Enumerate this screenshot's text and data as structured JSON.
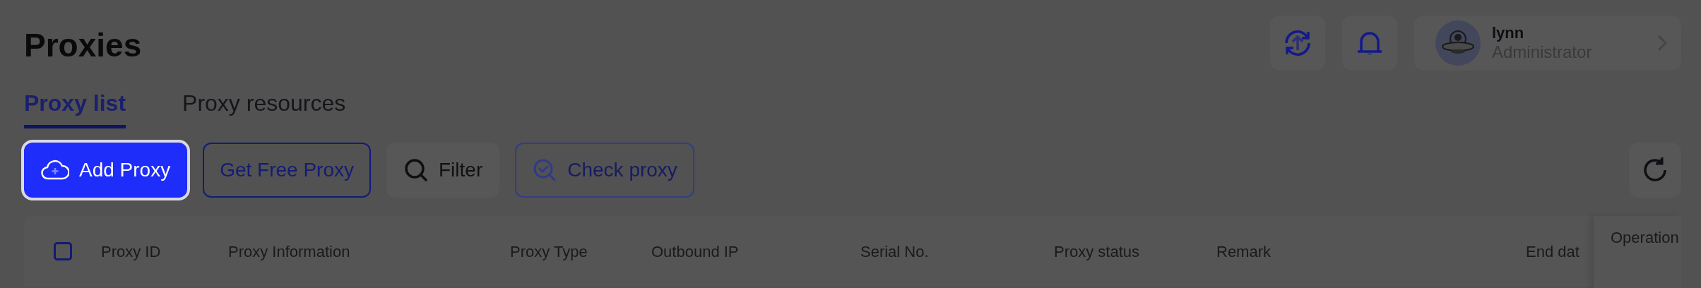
{
  "header": {
    "title": "Proxies",
    "user": {
      "name": "lynn",
      "role": "Administrator"
    }
  },
  "tabs": [
    {
      "label": "Proxy list",
      "selected": true
    },
    {
      "label": "Proxy resources",
      "selected": false
    }
  ],
  "toolbar": [
    {
      "label": "Add Proxy",
      "kind": "primary",
      "disabled": false
    },
    {
      "label": "Get Free Proxy",
      "kind": "outline",
      "disabled": false
    },
    {
      "label": "Filter",
      "kind": "filter",
      "disabled": false
    },
    {
      "label": "Check proxy",
      "kind": "check",
      "disabled": true
    }
  ],
  "table": {
    "select_all": {
      "checked": false
    },
    "columns": [
      "Proxy ID",
      "Proxy Information",
      "Proxy Type",
      "Outbound IP",
      "Serial No.",
      "Proxy status",
      "Remark",
      "End dat"
    ],
    "sticky_column": "Operation"
  }
}
